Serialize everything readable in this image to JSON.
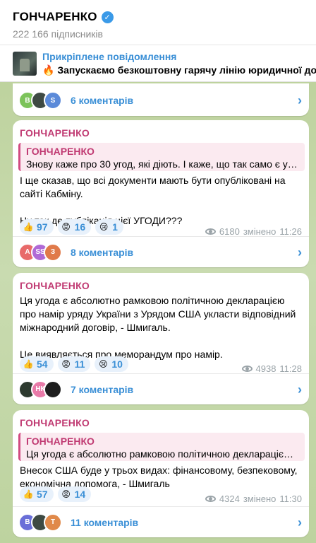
{
  "header": {
    "title": "ГОНЧАРЕНКО",
    "subscribers": "222 166 підписників"
  },
  "pinned": {
    "label": "Прикріплене повідомлення",
    "message": "🔥 Запускаємо безкоштовну гарячу лінію юридичної допомоги"
  },
  "posts": [
    {
      "comments": {
        "label": "6 коментарів",
        "avatars": [
          "В",
          "",
          "S"
        ]
      }
    },
    {
      "author": "ГОНЧАРЕНКО",
      "quote": {
        "author": "ГОНЧАРЕНКО",
        "text": "Знову каже про 30 угод, які діють.   І каже, що так само є угод..."
      },
      "paragraphs": [
        "І ще сказав, що всі документи мають бути опубліковані на сайті Кабміну.",
        "Ну так де публікація цієї УГОДИ???"
      ],
      "reactions": [
        {
          "emoji": "👍",
          "count": "97"
        },
        {
          "emoji": "😡",
          "count": "16"
        },
        {
          "emoji": "😢",
          "count": "1"
        }
      ],
      "views": "6180",
      "edited": "змінено",
      "time": "11:26",
      "comments": {
        "label": "8 коментарів",
        "avatars": [
          "A",
          "SS",
          "З"
        ]
      }
    },
    {
      "author": "ГОНЧАРЕНКО",
      "paragraphs": [
        "Ця угода є абсолютно рамковою політичною декларацією про намір уряду України з Урядом США укласти відповідний міжнародний договір, - Шмигаль.",
        "Це виявляється про меморандум про намір."
      ],
      "reactions": [
        {
          "emoji": "👍",
          "count": "54"
        },
        {
          "emoji": "😡",
          "count": "11"
        },
        {
          "emoji": "😢",
          "count": "10"
        }
      ],
      "views": "4938",
      "time": "11:28",
      "comments": {
        "label": "7 коментарів",
        "avatars": [
          "",
          "НК",
          ""
        ]
      }
    },
    {
      "author": "ГОНЧАРЕНКО",
      "quote": {
        "author": "ГОНЧАРЕНКО",
        "text": "Ця угода є абсолютно рамковою політичною декларацією п..."
      },
      "paragraphs": [
        "Внесок США буде у трьох видах: фінансовому, безпековому, економічна допомога, - Шмигаль"
      ],
      "reactions": [
        {
          "emoji": "👍",
          "count": "57"
        },
        {
          "emoji": "😡",
          "count": "14"
        }
      ],
      "views": "4324",
      "edited": "змінено",
      "time": "11:30",
      "comments": {
        "label": "11 коментарів",
        "avatars": [
          "В",
          "",
          "Т"
        ]
      }
    }
  ],
  "chevron": "›",
  "colors": {
    "accent": "#3a8fd6",
    "author": "#c03a72",
    "background": "#c3d5a6"
  }
}
